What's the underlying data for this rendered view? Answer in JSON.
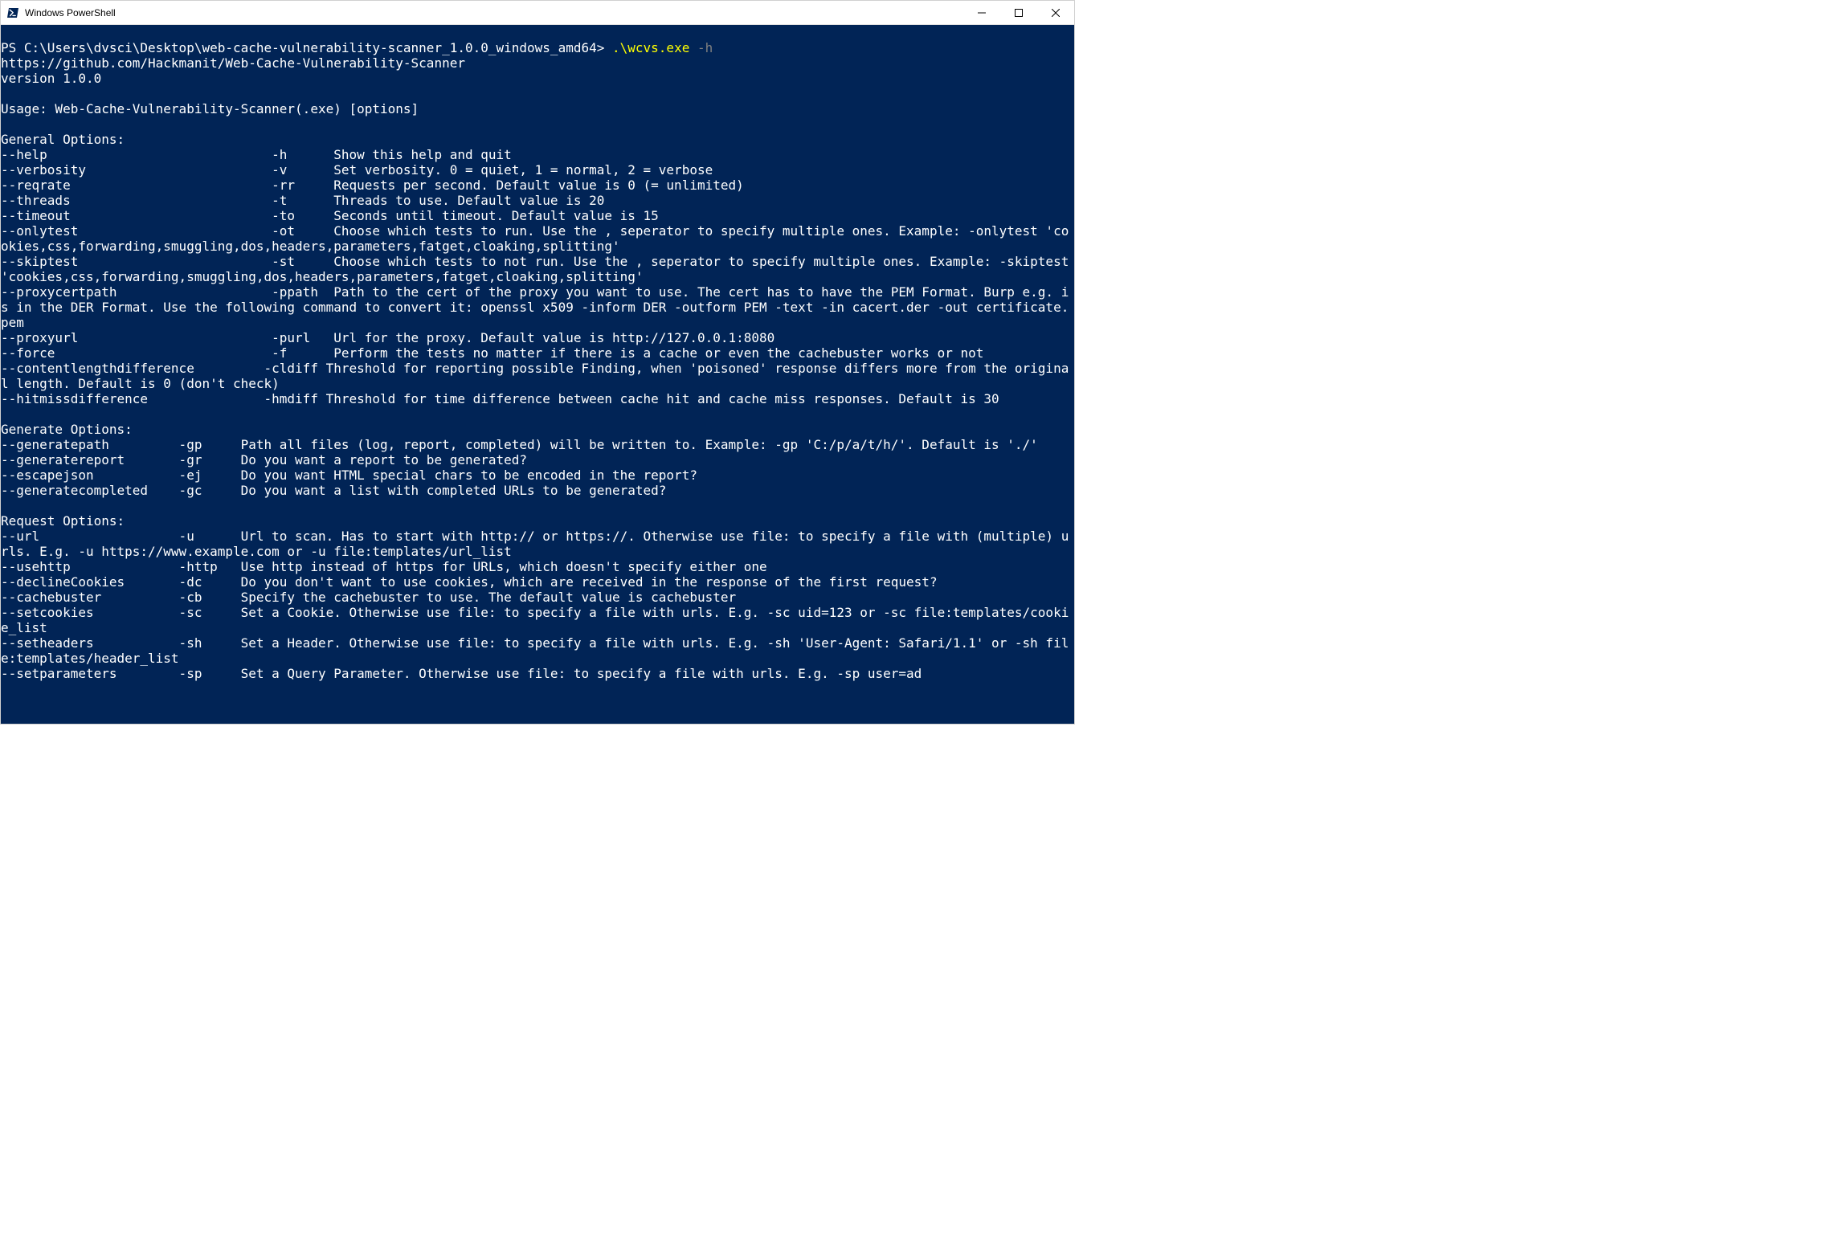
{
  "window": {
    "title": "Windows PowerShell"
  },
  "prompt": {
    "ps": "PS C:\\Users\\dvsci\\Desktop\\web-cache-vulnerability-scanner_1.0.0_windows_amd64> ",
    "cmd": ".\\wcvs.exe",
    "arg": " -h"
  },
  "output": "https://github.com/Hackmanit/Web-Cache-Vulnerability-Scanner\nversion 1.0.0\n\nUsage: Web-Cache-Vulnerability-Scanner(.exe) [options]\n\nGeneral Options:\n--help                             -h      Show this help and quit\n--verbosity                        -v      Set verbosity. 0 = quiet, 1 = normal, 2 = verbose\n--reqrate                          -rr     Requests per second. Default value is 0 (= unlimited)\n--threads                          -t      Threads to use. Default value is 20\n--timeout                          -to     Seconds until timeout. Default value is 15\n--onlytest                         -ot     Choose which tests to run. Use the , seperator to specify multiple ones. Example: -onlytest 'cookies,css,forwarding,smuggling,dos,headers,parameters,fatget,cloaking,splitting'\n--skiptest                         -st     Choose which tests to not run. Use the , seperator to specify multiple ones. Example: -skiptest 'cookies,css,forwarding,smuggling,dos,headers,parameters,fatget,cloaking,splitting'\n--proxycertpath                    -ppath  Path to the cert of the proxy you want to use. The cert has to have the PEM Format. Burp e.g. is in the DER Format. Use the following command to convert it: openssl x509 -inform DER -outform PEM -text -in cacert.der -out certificate.pem\n--proxyurl                         -purl   Url for the proxy. Default value is http://127.0.0.1:8080\n--force                            -f      Perform the tests no matter if there is a cache or even the cachebuster works or not\n--contentlengthdifference         -cldiff Threshold for reporting possible Finding, when 'poisoned' response differs more from the original length. Default is 0 (don't check)\n--hitmissdifference               -hmdiff Threshold for time difference between cache hit and cache miss responses. Default is 30\n\nGenerate Options:\n--generatepath         -gp     Path all files (log, report, completed) will be written to. Example: -gp 'C:/p/a/t/h/'. Default is './'\n--generatereport       -gr     Do you want a report to be generated?\n--escapejson           -ej     Do you want HTML special chars to be encoded in the report?\n--generatecompleted    -gc     Do you want a list with completed URLs to be generated?\n\nRequest Options:\n--url                  -u      Url to scan. Has to start with http:// or https://. Otherwise use file: to specify a file with (multiple) urls. E.g. -u https://www.example.com or -u file:templates/url_list\n--usehttp              -http   Use http instead of https for URLs, which doesn't specify either one\n--declineCookies       -dc     Do you don't want to use cookies, which are received in the response of the first request?\n--cachebuster          -cb     Specify the cachebuster to use. The default value is cachebuster\n--setcookies           -sc     Set a Cookie. Otherwise use file: to specify a file with urls. E.g. -sc uid=123 or -sc file:templates/cookie_list\n--setheaders           -sh     Set a Header. Otherwise use file: to specify a file with urls. E.g. -sh 'User-Agent: Safari/1.1' or -sh file:templates/header_list\n--setparameters        -sp     Set a Query Parameter. Otherwise use file: to specify a file with urls. E.g. -sp user=ad"
}
